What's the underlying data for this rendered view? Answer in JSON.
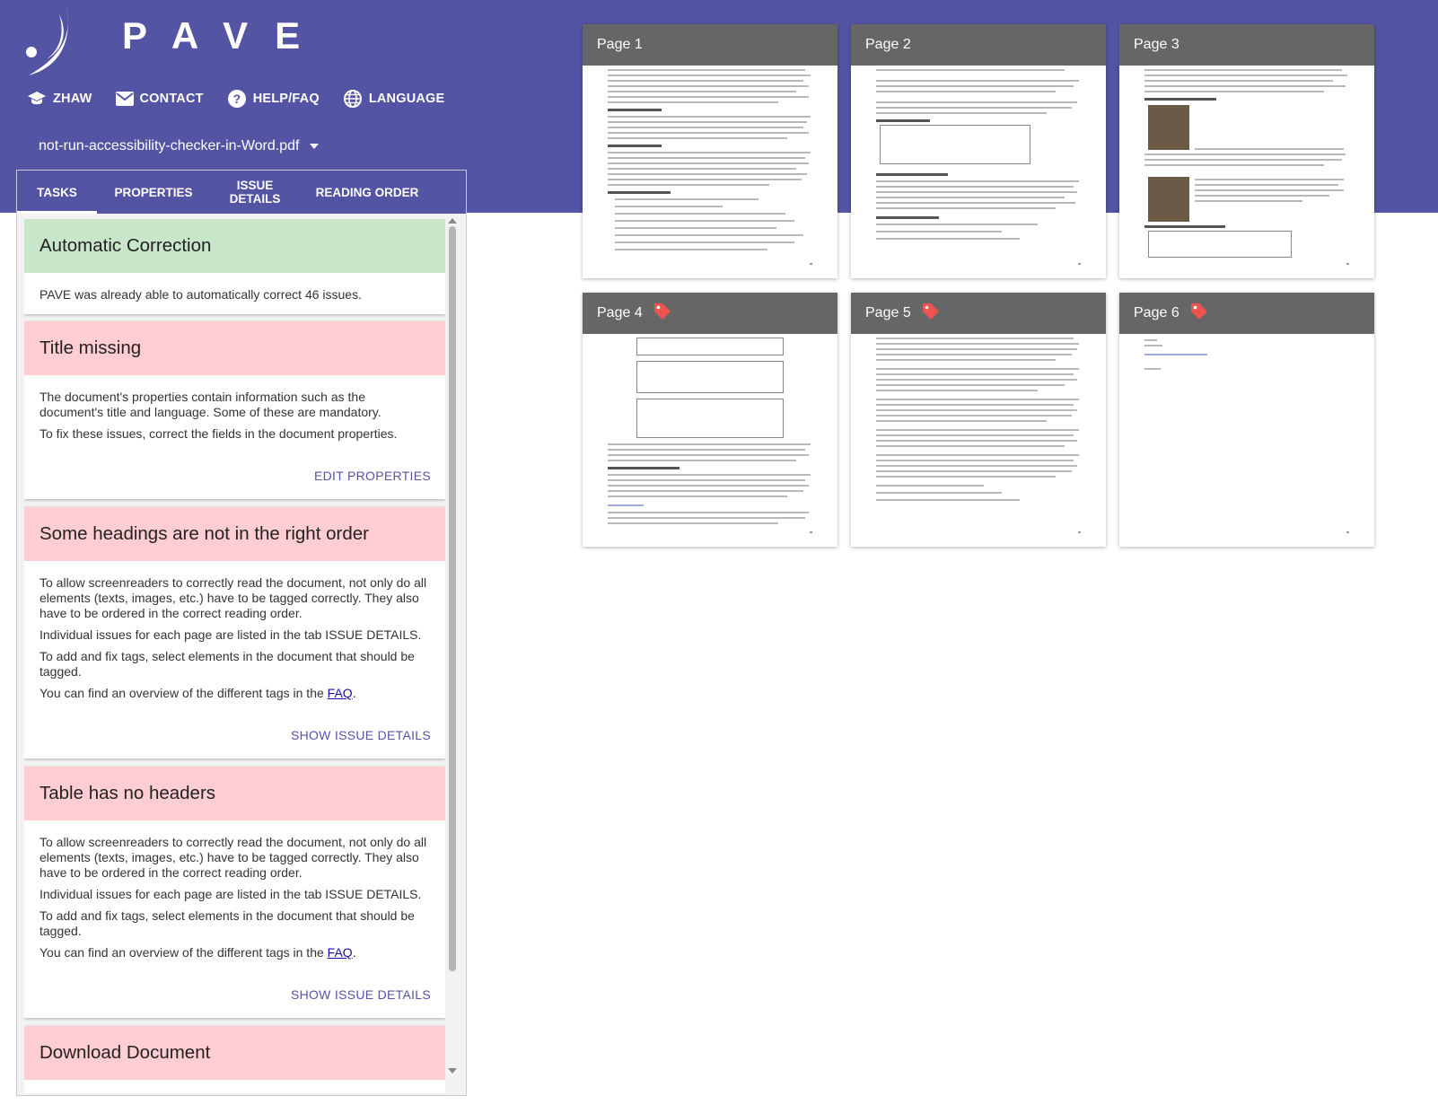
{
  "app": {
    "brand": "PAVE",
    "nav": [
      {
        "label": "ZHAW",
        "icon": "graduation-cap-icon"
      },
      {
        "label": "CONTACT",
        "icon": "mail-icon"
      },
      {
        "label": "HELP/FAQ",
        "icon": "help-circle-icon"
      },
      {
        "label": "LANGUAGE",
        "icon": "globe-icon"
      }
    ],
    "file_name": "not-run-accessibility-checker-in-Word.pdf",
    "colors": {
      "primary": "#5454a5",
      "success_bg": "#c8e6c9",
      "error_bg": "#ffcdd2"
    }
  },
  "tabs": [
    {
      "label": "TASKS",
      "active": true
    },
    {
      "label": "PROPERTIES",
      "active": false
    },
    {
      "label": "ISSUE DETAILS",
      "active": false
    },
    {
      "label": "READING ORDER",
      "active": false
    }
  ],
  "cards": {
    "auto": {
      "title": "Automatic Correction",
      "text": "PAVE was already able to automatically correct 46 issues."
    },
    "title_missing": {
      "title": "Title missing",
      "p1": "The document's properties contain information such as the document's title and language. Some of these are mandatory.",
      "p2": "To fix these issues, correct the fields in the document properties.",
      "action": "EDIT PROPERTIES"
    },
    "headings": {
      "title": "Some headings are not in the right order",
      "p1": "To allow screenreaders to correctly read the document, not only do all elements (texts, images, etc.) have to be tagged correctly. They also have to be ordered in the correct reading order.",
      "p2": "Individual issues for each page are listed in the tab ISSUE DETAILS.",
      "p3": "To add and fix tags, select elements in the document that should be tagged.",
      "p4_prefix": "You can find an overview of the different tags in the ",
      "p4_link": "FAQ",
      "p4_suffix": ".",
      "action": "SHOW ISSUE DETAILS"
    },
    "table": {
      "title": "Table has no headers",
      "p1": "To allow screenreaders to correctly read the document, not only do all elements (texts, images, etc.) have to be tagged correctly. They also have to be ordered in the correct reading order.",
      "p2": "Individual issues for each page are listed in the tab ISSUE DETAILS.",
      "p3": "To add and fix tags, select elements in the document that should be tagged.",
      "p4_prefix": "You can find an overview of the different tags in the ",
      "p4_link": "FAQ",
      "p4_suffix": ".",
      "action": "SHOW ISSUE DETAILS"
    },
    "download": {
      "title": "Download Document"
    }
  },
  "pages": [
    {
      "label": "Page 1",
      "tagged_issue": false
    },
    {
      "label": "Page 2",
      "tagged_issue": false
    },
    {
      "label": "Page 3",
      "tagged_issue": false
    },
    {
      "label": "Page 4",
      "tagged_issue": true
    },
    {
      "label": "Page 5",
      "tagged_issue": true
    },
    {
      "label": "Page 6",
      "tagged_issue": true
    }
  ]
}
